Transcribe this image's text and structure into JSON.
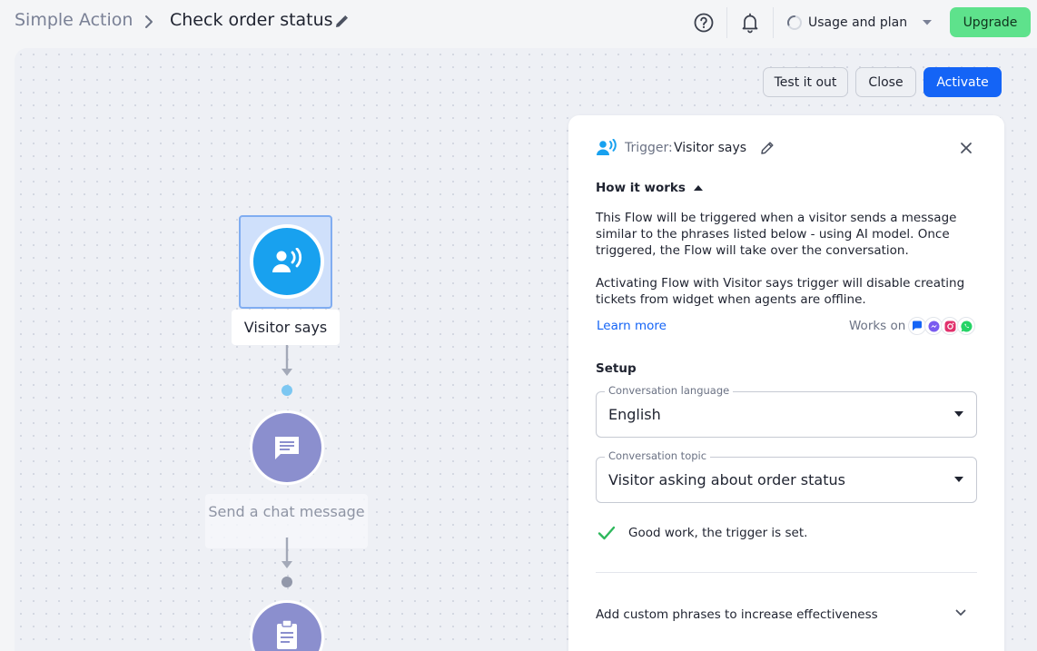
{
  "header": {
    "breadcrumb_root": "Simple Action",
    "title": "Check order status",
    "usage_label": "Usage and plan",
    "upgrade_label": "Upgrade"
  },
  "toolbar": {
    "test_label": "Test it out",
    "close_label": "Close",
    "activate_label": "Activate"
  },
  "flow": {
    "trigger_label": "Visitor says",
    "chat_label": "Send a chat message"
  },
  "panel": {
    "trigger_prefix": "Trigger:",
    "trigger_name": "Visitor says",
    "how_title": "How it works",
    "desc1": "This Flow will be triggered when a visitor sends a message similar to the phrases listed below - using AI model. Once triggered, the Flow will take over the conversation.",
    "desc2": "Activating Flow with Visitor says trigger will disable creating tickets from widget when agents are offline.",
    "learn_more": "Learn more",
    "works_on": "Works on",
    "channels": [
      "livechat-icon",
      "messenger-icon",
      "instagram-icon",
      "whatsapp-icon"
    ],
    "setup_title": "Setup",
    "language": {
      "legend": "Conversation language",
      "value": "English"
    },
    "topic": {
      "legend": "Conversation topic",
      "value": "Visitor asking about order status"
    },
    "success": "Good work, the trigger is set.",
    "custom_phrases": "Add custom phrases to increase effectiveness"
  },
  "colors": {
    "primary": "#1464f6",
    "upgrade": "#5ee28c",
    "trigger": "#18a1ef",
    "action": "#8b8fce",
    "success": "#2eb85c"
  }
}
